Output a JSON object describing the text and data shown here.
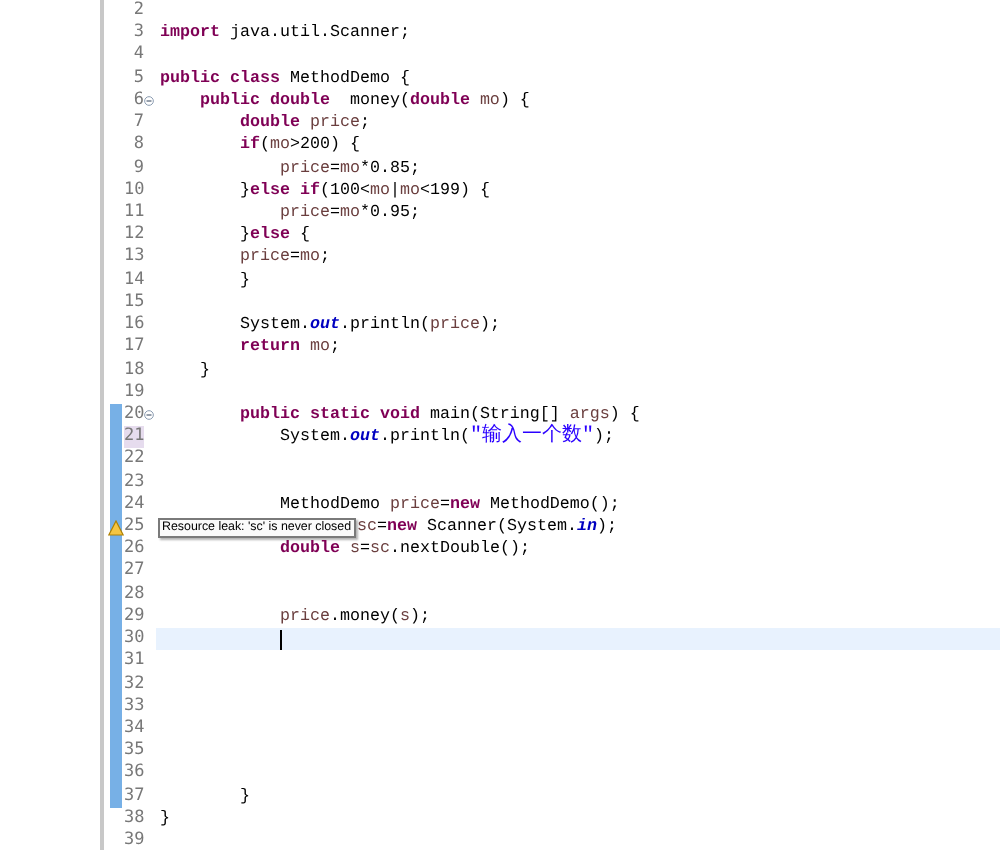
{
  "editor": {
    "lines": [
      {
        "n": "2",
        "changed": false,
        "current": false,
        "foldable": false,
        "warning": false,
        "occurrence": false
      },
      {
        "n": "3",
        "changed": false,
        "current": false,
        "foldable": false,
        "warning": false,
        "occurrence": false,
        "tokens": [
          {
            "text": "import ",
            "kind": "kw"
          },
          {
            "text": "java.util.Scanner;",
            "kind": "plain"
          }
        ]
      },
      {
        "n": "4",
        "changed": false,
        "current": false,
        "foldable": false,
        "warning": false,
        "occurrence": false
      },
      {
        "n": "5",
        "changed": false,
        "current": false,
        "foldable": false,
        "warning": false,
        "occurrence": false,
        "tokens": [
          {
            "text": "public class",
            "kind": "kw"
          },
          {
            "text": " MethodDemo {",
            "kind": "plain"
          }
        ]
      },
      {
        "n": "6",
        "changed": false,
        "current": false,
        "foldable": true,
        "warning": false,
        "occurrence": false,
        "tokens": [
          {
            "text": "    public double",
            "kind": "kw"
          },
          {
            "text": "  money(",
            "kind": "plain"
          },
          {
            "text": "double ",
            "kind": "kw"
          },
          {
            "text": "mo",
            "kind": "var"
          },
          {
            "text": ") {",
            "kind": "plain"
          }
        ]
      },
      {
        "n": "7",
        "changed": false,
        "current": false,
        "foldable": false,
        "warning": false,
        "occurrence": false,
        "tokens": [
          {
            "text": "        double ",
            "kind": "kw"
          },
          {
            "text": "price",
            "kind": "var"
          },
          {
            "text": ";",
            "kind": "plain"
          }
        ]
      },
      {
        "n": "8",
        "changed": false,
        "current": false,
        "foldable": false,
        "warning": false,
        "occurrence": false,
        "tokens": [
          {
            "text": "        if",
            "kind": "kw"
          },
          {
            "text": "(",
            "kind": "plain"
          },
          {
            "text": "mo",
            "kind": "var"
          },
          {
            "text": ">200) {",
            "kind": "plain"
          }
        ]
      },
      {
        "n": "9",
        "changed": false,
        "current": false,
        "foldable": false,
        "warning": false,
        "occurrence": false,
        "tokens": [
          {
            "text": "            price",
            "kind": "var"
          },
          {
            "text": "=",
            "kind": "plain"
          },
          {
            "text": "mo",
            "kind": "var"
          },
          {
            "text": "*0.85;",
            "kind": "plain"
          }
        ]
      },
      {
        "n": "10",
        "changed": false,
        "current": false,
        "foldable": false,
        "warning": false,
        "occurrence": false,
        "tokens": [
          {
            "text": "        }",
            "kind": "plain"
          },
          {
            "text": "else if",
            "kind": "kw"
          },
          {
            "text": "(100<",
            "kind": "plain"
          },
          {
            "text": "mo",
            "kind": "var"
          },
          {
            "text": "|",
            "kind": "plain"
          },
          {
            "text": "mo",
            "kind": "var"
          },
          {
            "text": "<199) {",
            "kind": "plain"
          }
        ]
      },
      {
        "n": "11",
        "changed": false,
        "current": false,
        "foldable": false,
        "warning": false,
        "occurrence": false,
        "tokens": [
          {
            "text": "            price",
            "kind": "var"
          },
          {
            "text": "=",
            "kind": "plain"
          },
          {
            "text": "mo",
            "kind": "var"
          },
          {
            "text": "*0.95;",
            "kind": "plain"
          }
        ]
      },
      {
        "n": "12",
        "changed": false,
        "current": false,
        "foldable": false,
        "warning": false,
        "occurrence": false,
        "tokens": [
          {
            "text": "        }",
            "kind": "plain"
          },
          {
            "text": "else",
            "kind": "kw"
          },
          {
            "text": " {",
            "kind": "plain"
          }
        ]
      },
      {
        "n": "13",
        "changed": false,
        "current": false,
        "foldable": false,
        "warning": false,
        "occurrence": false,
        "tokens": [
          {
            "text": "        price",
            "kind": "var"
          },
          {
            "text": "=",
            "kind": "plain"
          },
          {
            "text": "mo",
            "kind": "var"
          },
          {
            "text": ";",
            "kind": "plain"
          }
        ]
      },
      {
        "n": "14",
        "changed": false,
        "current": false,
        "foldable": false,
        "warning": false,
        "occurrence": false,
        "tokens": [
          {
            "text": "        }",
            "kind": "plain"
          }
        ]
      },
      {
        "n": "15",
        "changed": false,
        "current": false,
        "foldable": false,
        "warning": false,
        "occurrence": false
      },
      {
        "n": "16",
        "changed": false,
        "current": false,
        "foldable": false,
        "warning": false,
        "occurrence": false,
        "tokens": [
          {
            "text": "        System.",
            "kind": "plain"
          },
          {
            "text": "out",
            "kind": "field"
          },
          {
            "text": ".println(",
            "kind": "plain"
          },
          {
            "text": "price",
            "kind": "var"
          },
          {
            "text": ");",
            "kind": "plain"
          }
        ]
      },
      {
        "n": "17",
        "changed": false,
        "current": false,
        "foldable": false,
        "warning": false,
        "occurrence": false,
        "tokens": [
          {
            "text": "        return ",
            "kind": "kw"
          },
          {
            "text": "mo",
            "kind": "var"
          },
          {
            "text": ";",
            "kind": "plain"
          }
        ]
      },
      {
        "n": "18",
        "changed": false,
        "current": false,
        "foldable": false,
        "warning": false,
        "occurrence": false,
        "tokens": [
          {
            "text": "    }",
            "kind": "plain"
          }
        ]
      },
      {
        "n": "19",
        "changed": false,
        "current": false,
        "foldable": false,
        "warning": false,
        "occurrence": false
      },
      {
        "n": "20",
        "changed": true,
        "current": false,
        "foldable": true,
        "warning": false,
        "occurrence": false,
        "tokens": [
          {
            "text": "        public static void",
            "kind": "kw"
          },
          {
            "text": " main(String[] ",
            "kind": "plain"
          },
          {
            "text": "args",
            "kind": "var"
          },
          {
            "text": ") {",
            "kind": "plain"
          }
        ]
      },
      {
        "n": "21",
        "changed": true,
        "current": false,
        "foldable": false,
        "warning": false,
        "occurrence": true,
        "tokens": [
          {
            "text": "            System.",
            "kind": "plain"
          },
          {
            "text": "out",
            "kind": "field"
          },
          {
            "text": ".println(",
            "kind": "plain"
          },
          {
            "text": "\"输入一个数\"",
            "kind": "str"
          },
          {
            "text": ");",
            "kind": "plain"
          }
        ]
      },
      {
        "n": "22",
        "changed": true,
        "current": false,
        "foldable": false,
        "warning": false,
        "occurrence": false
      },
      {
        "n": "23",
        "changed": true,
        "current": false,
        "foldable": false,
        "warning": false,
        "occurrence": false
      },
      {
        "n": "24",
        "changed": true,
        "current": false,
        "foldable": false,
        "warning": false,
        "occurrence": false,
        "tokens": [
          {
            "text": "            MethodDemo ",
            "kind": "plain"
          },
          {
            "text": "price",
            "kind": "var"
          },
          {
            "text": "=",
            "kind": "plain"
          },
          {
            "text": "new",
            "kind": "kw"
          },
          {
            "text": " MethodDemo();",
            "kind": "plain"
          }
        ]
      },
      {
        "n": "25",
        "changed": true,
        "current": false,
        "foldable": false,
        "warning": true,
        "occurrence": false,
        "tokens": [
          {
            "text": "sc",
            "kind": "var"
          },
          {
            "text": "=",
            "kind": "plain"
          },
          {
            "text": "new",
            "kind": "kw"
          },
          {
            "text": " Scanner(System.",
            "kind": "plain"
          },
          {
            "text": "in",
            "kind": "field"
          },
          {
            "text": ");",
            "kind": "plain"
          }
        ]
      },
      {
        "n": "26",
        "changed": true,
        "current": false,
        "foldable": false,
        "warning": false,
        "occurrence": false,
        "tokens": [
          {
            "text": "            double ",
            "kind": "kw"
          },
          {
            "text": "s",
            "kind": "var"
          },
          {
            "text": "=",
            "kind": "plain"
          },
          {
            "text": "sc",
            "kind": "var"
          },
          {
            "text": ".nextDouble();",
            "kind": "plain"
          }
        ]
      },
      {
        "n": "27",
        "changed": true,
        "current": false,
        "foldable": false,
        "warning": false,
        "occurrence": false
      },
      {
        "n": "28",
        "changed": true,
        "current": false,
        "foldable": false,
        "warning": false,
        "occurrence": false
      },
      {
        "n": "29",
        "changed": true,
        "current": false,
        "foldable": false,
        "warning": false,
        "occurrence": false,
        "tokens": [
          {
            "text": "            price",
            "kind": "var"
          },
          {
            "text": ".money(",
            "kind": "plain"
          },
          {
            "text": "s",
            "kind": "var"
          },
          {
            "text": ");",
            "kind": "plain"
          }
        ]
      },
      {
        "n": "30",
        "changed": true,
        "current": true,
        "foldable": false,
        "warning": false,
        "occurrence": false
      },
      {
        "n": "31",
        "changed": true,
        "current": false,
        "foldable": false,
        "warning": false,
        "occurrence": false
      },
      {
        "n": "32",
        "changed": true,
        "current": false,
        "foldable": false,
        "warning": false,
        "occurrence": false
      },
      {
        "n": "33",
        "changed": true,
        "current": false,
        "foldable": false,
        "warning": false,
        "occurrence": false
      },
      {
        "n": "34",
        "changed": true,
        "current": false,
        "foldable": false,
        "warning": false,
        "occurrence": false
      },
      {
        "n": "35",
        "changed": true,
        "current": false,
        "foldable": false,
        "warning": false,
        "occurrence": false
      },
      {
        "n": "36",
        "changed": true,
        "current": false,
        "foldable": false,
        "warning": false,
        "occurrence": false
      },
      {
        "n": "37",
        "changed": true,
        "current": false,
        "foldable": false,
        "warning": false,
        "occurrence": false,
        "tokens": [
          {
            "text": "        }",
            "kind": "plain"
          }
        ]
      },
      {
        "n": "38",
        "changed": false,
        "current": false,
        "foldable": false,
        "warning": false,
        "occurrence": false,
        "tokens": [
          {
            "text": "}",
            "kind": "plain"
          }
        ]
      },
      {
        "n": "39",
        "changed": false,
        "current": false,
        "foldable": false,
        "warning": false,
        "occurrence": false
      }
    ],
    "tooltip": {
      "text": "Resource leak: 'sc' is never closed"
    }
  }
}
